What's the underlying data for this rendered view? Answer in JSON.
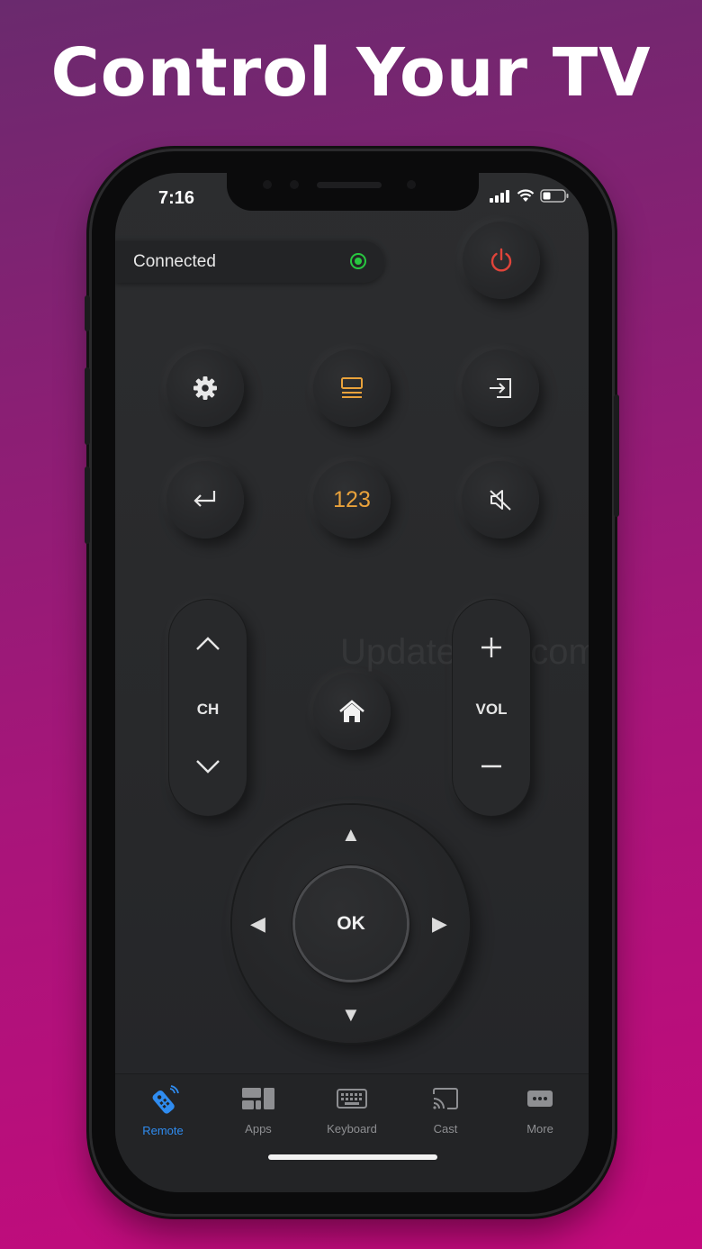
{
  "headline": "Control Your TV",
  "status_bar": {
    "time": "7:16"
  },
  "connection": {
    "label": "Connected",
    "status_color": "#28c840"
  },
  "remote": {
    "power_icon": "power-icon",
    "settings_icon": "gear-icon",
    "guide_icon": "guide-list-icon",
    "input_icon": "input-source-icon",
    "back_icon": "return-arrow-icon",
    "numpad_label": "123",
    "mute_icon": "mute-icon",
    "home_icon": "home-icon",
    "channel": {
      "label": "CH"
    },
    "volume": {
      "label": "VOL"
    },
    "dpad": {
      "ok_label": "OK"
    }
  },
  "watermark": "UpdateStar.com",
  "tabs": [
    {
      "label": "Remote",
      "icon": "remote-icon",
      "active": true
    },
    {
      "label": "Apps",
      "icon": "apps-grid-icon",
      "active": false
    },
    {
      "label": "Keyboard",
      "icon": "keyboard-icon",
      "active": false
    },
    {
      "label": "Cast",
      "icon": "cast-icon",
      "active": false
    },
    {
      "label": "More",
      "icon": "more-dots-icon",
      "active": false
    }
  ],
  "colors": {
    "accent_blue": "#2f8cf0",
    "accent_orange": "#e9a23b",
    "power_red": "#e0443a",
    "connected_green": "#28c840"
  }
}
